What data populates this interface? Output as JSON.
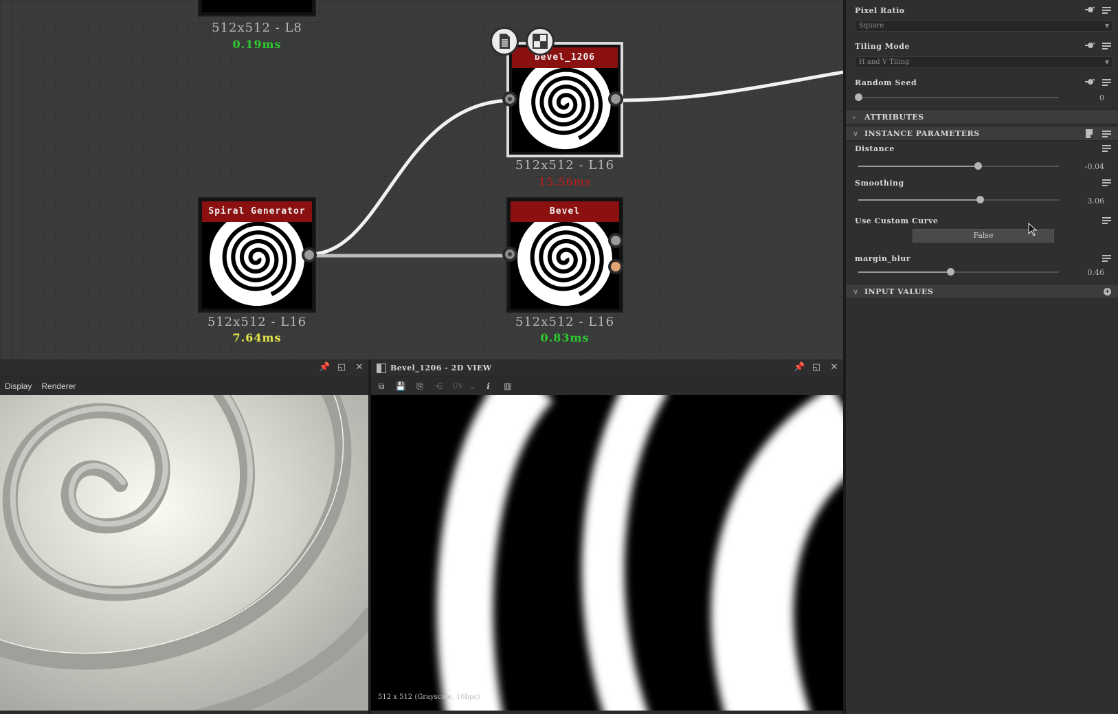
{
  "graph": {
    "nodes": [
      {
        "id": "top_partial",
        "resolution": "512x512 - L8",
        "time": "0.19ms",
        "time_color": "#2ecc2e"
      },
      {
        "id": "spiral",
        "title": "Spiral Generator",
        "resolution": "512x512 - L16",
        "time": "7.64ms",
        "time_color": "#e8e84a"
      },
      {
        "id": "bevel_1206",
        "title": "bevel_1206",
        "resolution": "512x512 - L16",
        "time": "15.56ms",
        "time_color": "#c81a1a"
      },
      {
        "id": "bevel",
        "title": "Bevel",
        "resolution": "512x512 - L16",
        "time": "0.83ms",
        "time_color": "#2ecc2e"
      }
    ],
    "badges": [
      {
        "name": "document-icon"
      },
      {
        "name": "checker-icon"
      }
    ]
  },
  "params": {
    "pixel_ratio": {
      "label": "Pixel Ratio",
      "value": "Square"
    },
    "tiling_mode": {
      "label": "Tiling Mode",
      "value": "H and V Tiling"
    },
    "random_seed": {
      "label": "Random Seed",
      "value": "0",
      "fraction": 0.0
    },
    "sections": {
      "attributes": "ATTRIBUTES",
      "instance_parameters": "INSTANCE PARAMETERS",
      "input_values": "INPUT VALUES"
    },
    "distance": {
      "label": "Distance",
      "value": "-0.04",
      "fraction": 0.595
    },
    "smoothing": {
      "label": "Smoothing",
      "value": "3.06",
      "fraction": 0.606
    },
    "use_custom_curve": {
      "label": "Use Custom Curve",
      "value": "False"
    },
    "margin_blur": {
      "label": "margin_blur",
      "value": "0.46",
      "fraction": 0.46
    }
  },
  "view3d": {
    "menu": [
      "Display",
      "Renderer"
    ]
  },
  "view2d": {
    "title": "Bevel_1206 - 2D VIEW",
    "uv_label": "UV",
    "status": "512 x 512 (Grayscale, 16bpc)"
  }
}
